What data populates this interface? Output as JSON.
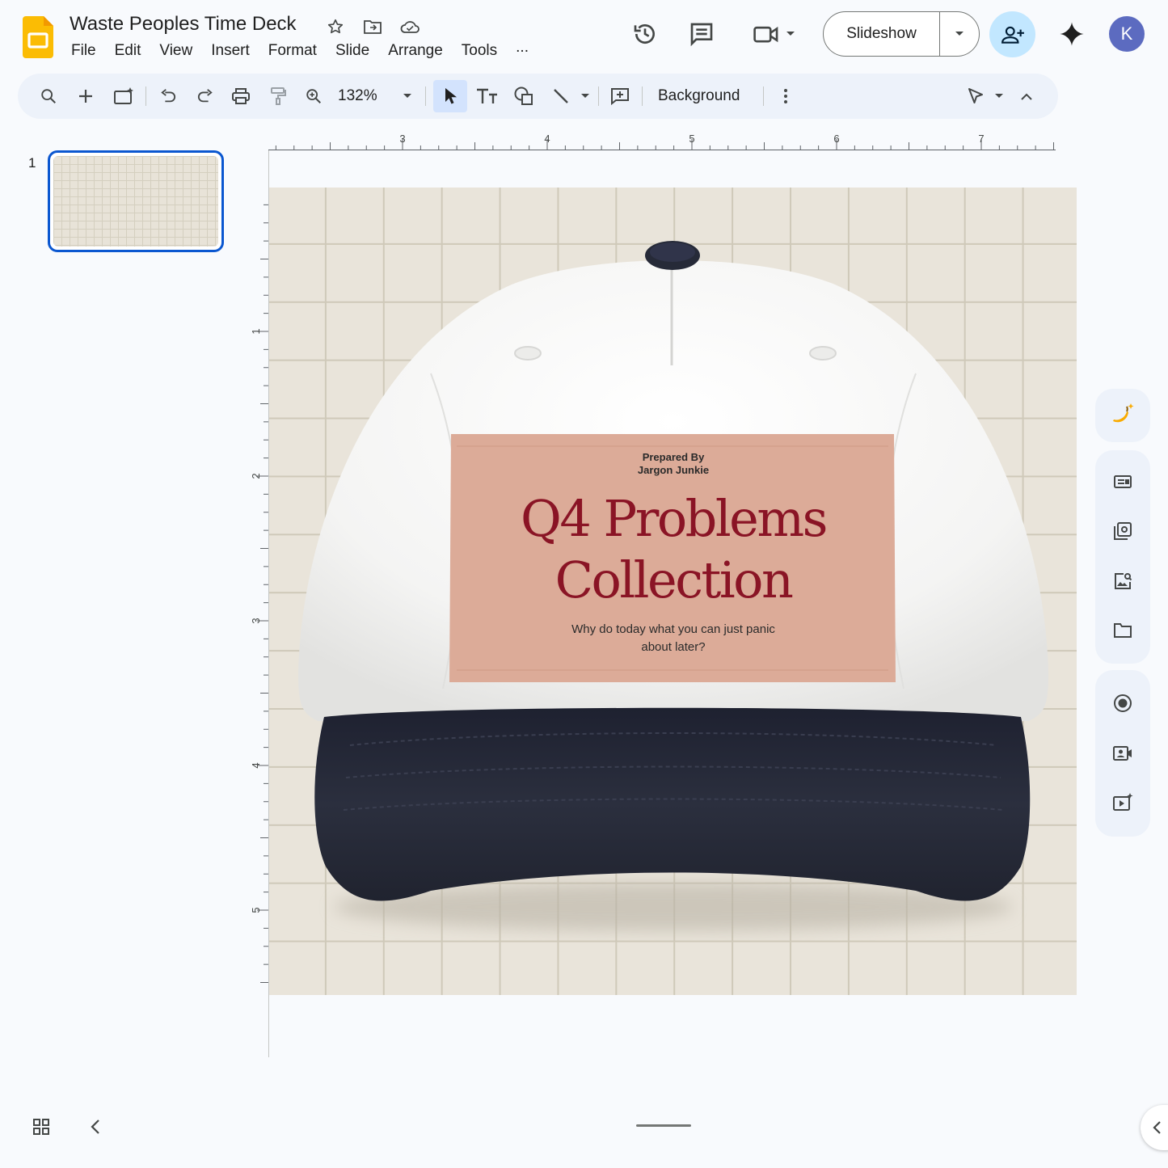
{
  "app": {
    "doc_title": "Waste Peoples Time Deck",
    "menu": [
      "File",
      "Edit",
      "View",
      "Insert",
      "Format",
      "Slide",
      "Arrange",
      "Tools",
      "..."
    ],
    "slideshow_label": "Slideshow",
    "avatar_letter": "K",
    "accent": "#0b57d0",
    "share_bg": "#c2e7ff"
  },
  "toolbar": {
    "zoom": "132%",
    "background_label": "Background"
  },
  "filmstrip": {
    "slides": [
      {
        "number": "1"
      }
    ]
  },
  "rulers": {
    "horizontal_labels": [
      "3",
      "4",
      "5",
      "6",
      "7"
    ],
    "vertical_labels": [
      "1",
      "2",
      "3",
      "4",
      "5"
    ]
  },
  "slide": {
    "prepared_by_line1": "Prepared By",
    "prepared_by_line2": "Jargon Junkie",
    "headline_line1": "Q4 Problems",
    "headline_line2": "Collection",
    "subtitle_line1": "Why do today what you can just panic",
    "subtitle_line2": "about later?",
    "colors": {
      "background": "#e9e4da",
      "grid": "#cfc9b9",
      "cap_crown": "#f5f5f4",
      "cap_brim": "#262a38",
      "label_patch": "#dcab98",
      "headline": "#8a1425"
    }
  },
  "side_panel": {
    "icons": [
      "banana-sparkle-icon",
      "speaker-notes-icon",
      "copy-slide-icon",
      "image-search-icon",
      "folder-icon",
      "record-icon",
      "camera-icon",
      "video-sparkle-icon"
    ]
  }
}
